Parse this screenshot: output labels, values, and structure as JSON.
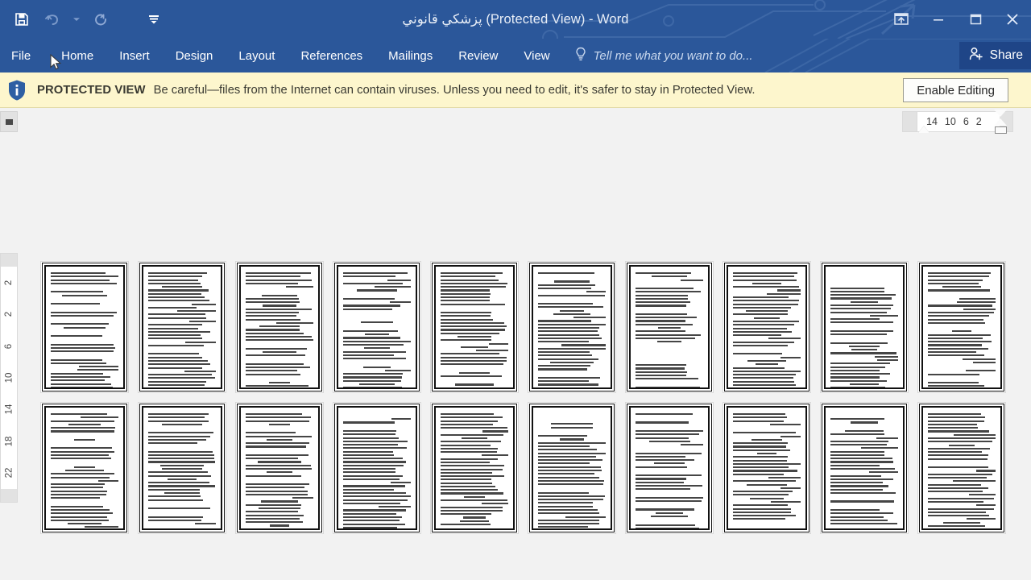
{
  "window": {
    "title": "پزشكي قانوني (Protected View) - Word",
    "accent_color": "#2b579a",
    "quick_access": [
      {
        "name": "save-icon",
        "label": "Save"
      },
      {
        "name": "undo-icon",
        "label": "Undo"
      },
      {
        "name": "undo-dropdown-icon",
        "label": "Undo options"
      },
      {
        "name": "redo-icon",
        "label": "Redo"
      },
      {
        "name": "customize-quick-access-icon",
        "label": "Customize Quick Access Toolbar"
      }
    ],
    "controls": [
      {
        "name": "ribbon-display-options-icon",
        "label": "Ribbon Display Options"
      },
      {
        "name": "minimize-icon",
        "label": "Minimize"
      },
      {
        "name": "restore-icon",
        "label": "Restore Down"
      },
      {
        "name": "close-icon",
        "label": "Close"
      }
    ]
  },
  "ribbon": {
    "tabs": [
      {
        "label": "File"
      },
      {
        "label": "Home"
      },
      {
        "label": "Insert"
      },
      {
        "label": "Design"
      },
      {
        "label": "Layout"
      },
      {
        "label": "References"
      },
      {
        "label": "Mailings"
      },
      {
        "label": "Review"
      },
      {
        "label": "View"
      }
    ],
    "tell_me": "Tell me what you want to do...",
    "share_label": "Share"
  },
  "protected_view": {
    "badge": "PROTECTED VIEW",
    "message": "Be careful—files from the Internet can contain viruses. Unless you need to edit, it's safer to stay in Protected View.",
    "button": "Enable Editing",
    "background_color": "#fdf6cd"
  },
  "rulers": {
    "horizontal_ticks": [
      "14",
      "10",
      "6",
      "2"
    ],
    "vertical_ticks": [
      "2",
      "2",
      "6",
      "10",
      "14",
      "18",
      "22"
    ]
  },
  "document": {
    "view": "Multiple Pages",
    "rows": 2,
    "columns": 10,
    "page_count": 20
  }
}
